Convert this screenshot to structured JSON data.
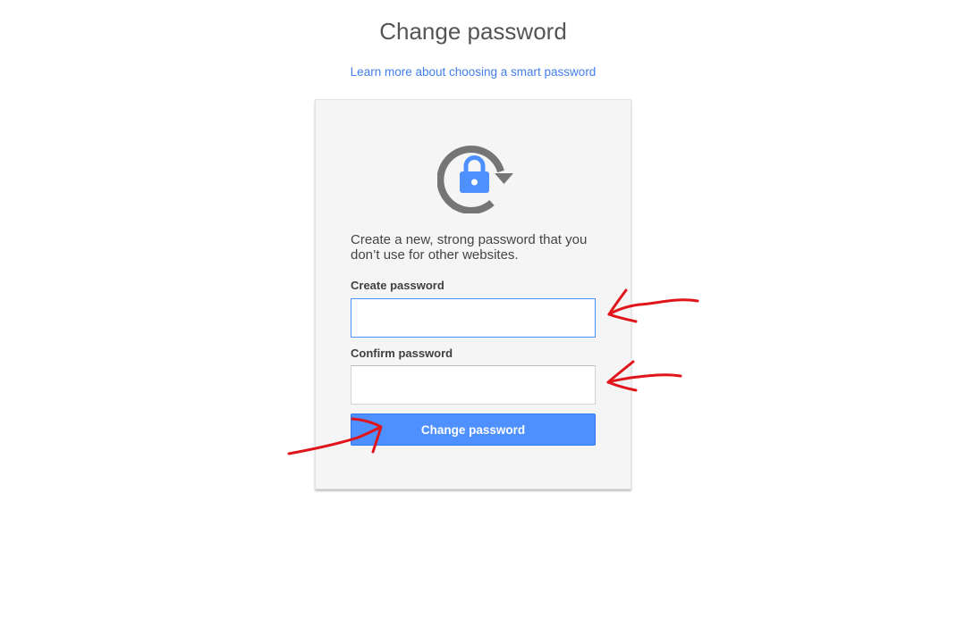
{
  "page": {
    "title": "Change password",
    "learn_more_link": "Learn more about choosing a smart password"
  },
  "card": {
    "icon": "lock-refresh-icon",
    "instructions": "Create a new, strong password that you don’t use for other websites.",
    "create_password": {
      "label": "Create password",
      "value": ""
    },
    "confirm_password": {
      "label": "Confirm password",
      "value": ""
    },
    "submit_label": "Change password"
  },
  "colors": {
    "accent": "#4d90fe",
    "link": "#427fed",
    "icon_gray": "#757575",
    "annotation_red": "#e0151b"
  },
  "annotations": [
    "red-arrow-icon",
    "red-arrow-icon",
    "red-arrow-icon"
  ]
}
